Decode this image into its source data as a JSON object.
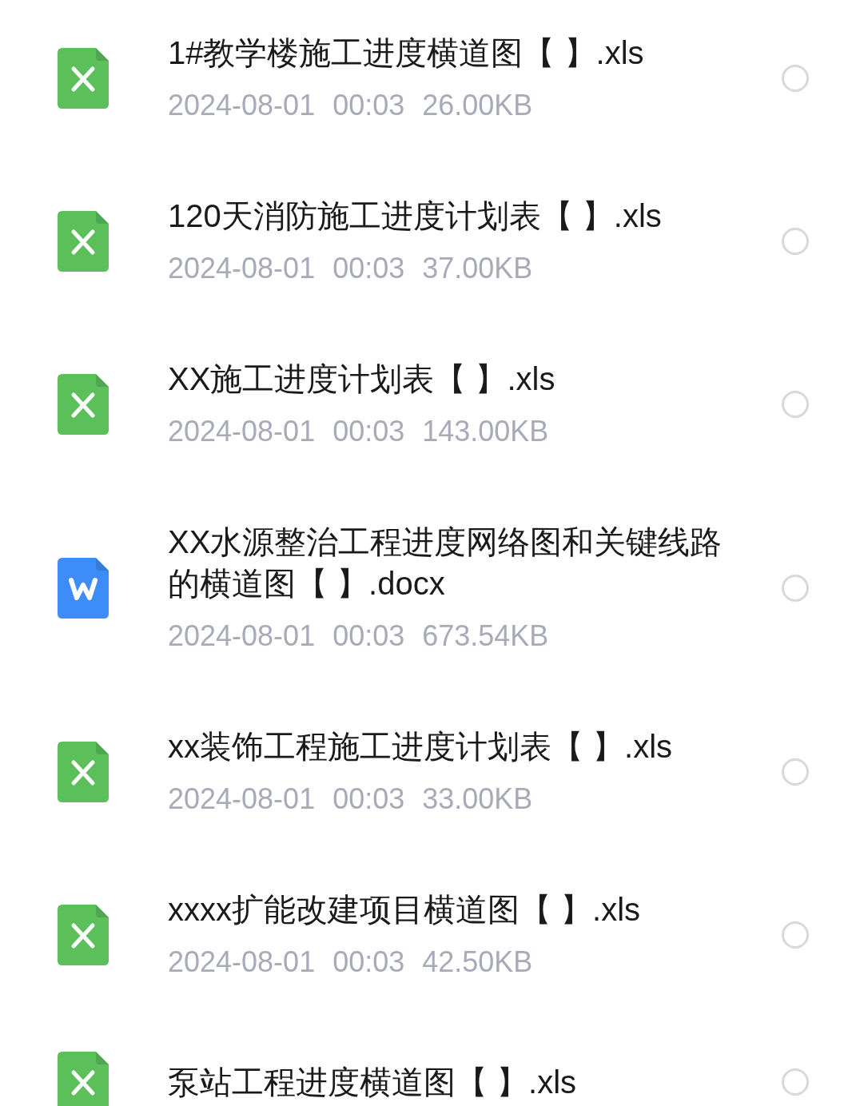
{
  "files": [
    {
      "kind": "xls",
      "name": "1#教学楼施工进度横道图【 】.xls",
      "date": "2024-08-01",
      "time": "00:03",
      "size": "26.00KB",
      "selected": false
    },
    {
      "kind": "xls",
      "name": "120天消防施工进度计划表【 】.xls",
      "date": "2024-08-01",
      "time": "00:03",
      "size": "37.00KB",
      "selected": false
    },
    {
      "kind": "xls",
      "name": "XX施工进度计划表【 】.xls",
      "date": "2024-08-01",
      "time": "00:03",
      "size": "143.00KB",
      "selected": false
    },
    {
      "kind": "docx",
      "name": "XX水源整治工程进度网络图和关键线路的横道图【 】.docx",
      "date": "2024-08-01",
      "time": "00:03",
      "size": "673.54KB",
      "selected": false
    },
    {
      "kind": "xls",
      "name": "xx装饰工程施工进度计划表【 】.xls",
      "date": "2024-08-01",
      "time": "00:03",
      "size": "33.00KB",
      "selected": false
    },
    {
      "kind": "xls",
      "name": "xxxx扩能改建项目横道图【 】.xls",
      "date": "2024-08-01",
      "time": "00:03",
      "size": "42.50KB",
      "selected": false
    },
    {
      "kind": "xls",
      "name": "泵站工程进度横道图【 】.xls",
      "selected": false
    }
  ]
}
